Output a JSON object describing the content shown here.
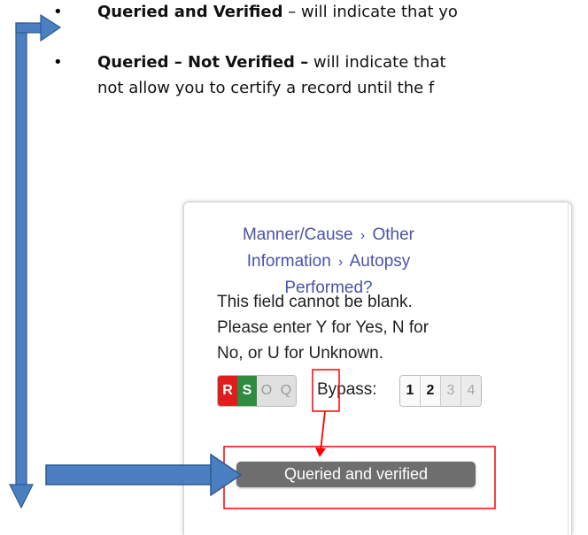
{
  "document": {
    "bullet1": {
      "bold": "Queried and Verified",
      "rest": " – will indicate that yo"
    },
    "bullet2_line1": {
      "bold": "Queried – Not Verified –",
      "rest": " will indicate that"
    },
    "bullet2_line2": "not allow you to certify a record until the f"
  },
  "panel": {
    "breadcrumb": {
      "part1": "Manner/Cause",
      "part2": "Other",
      "part3": "Information",
      "part4": "Autopsy",
      "part5": "Performed?",
      "separator": "›"
    },
    "message": {
      "line1": "This field cannot be blank.",
      "line2": "Please enter Y for Yes, N for",
      "line3": "No, or U for Unknown."
    },
    "status_buttons": {
      "r": "R",
      "s": "S",
      "o": "O",
      "q": "Q"
    },
    "bypass": {
      "label": "Bypass:",
      "n1": "1",
      "n2": "2",
      "n3": "3",
      "n4": "4"
    },
    "queried_verified_button": "Queried and verified"
  },
  "colors": {
    "arrow_blue": "#4a7fc1",
    "highlight_red": "#ff0000",
    "link_blue": "#4a53a8"
  },
  "icons": {
    "bullet": "bullet-dot",
    "arrow": "flow-arrow"
  }
}
